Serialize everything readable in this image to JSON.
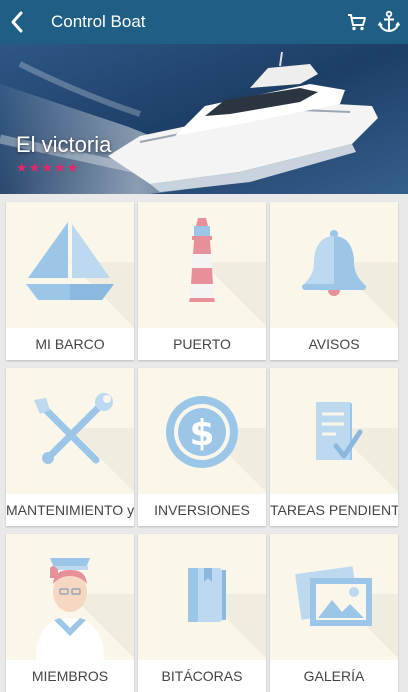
{
  "app": {
    "title": "Control Boat"
  },
  "icons": {
    "back": "chevron-left-icon",
    "cart": "cart-icon",
    "anchor": "anchor-icon"
  },
  "hero": {
    "boat_name": "El victoria",
    "rating_stars": 5,
    "stars_text": "★★★★★"
  },
  "colors": {
    "topbar": "#1f5f86",
    "accent_pink": "#e8246b",
    "tile_bg": "#fbf6ea",
    "icon_blue": "#9cc6e8"
  },
  "menu": [
    {
      "label": "MI BARCO",
      "icon": "sailboat-icon"
    },
    {
      "label": "PUERTO",
      "icon": "lighthouse-icon"
    },
    {
      "label": "AVISOS",
      "icon": "bell-icon"
    },
    {
      "label": "MANTENIMIENTO y",
      "icon": "tools-icon"
    },
    {
      "label": "INVERSIONES",
      "icon": "dollar-coin-icon"
    },
    {
      "label": "TAREAS PENDIENTE",
      "icon": "checklist-icon"
    },
    {
      "label": "MIEMBROS",
      "icon": "sailor-icon"
    },
    {
      "label": "BITÁCORAS",
      "icon": "logbook-icon"
    },
    {
      "label": "GALERÍA",
      "icon": "gallery-icon"
    }
  ]
}
